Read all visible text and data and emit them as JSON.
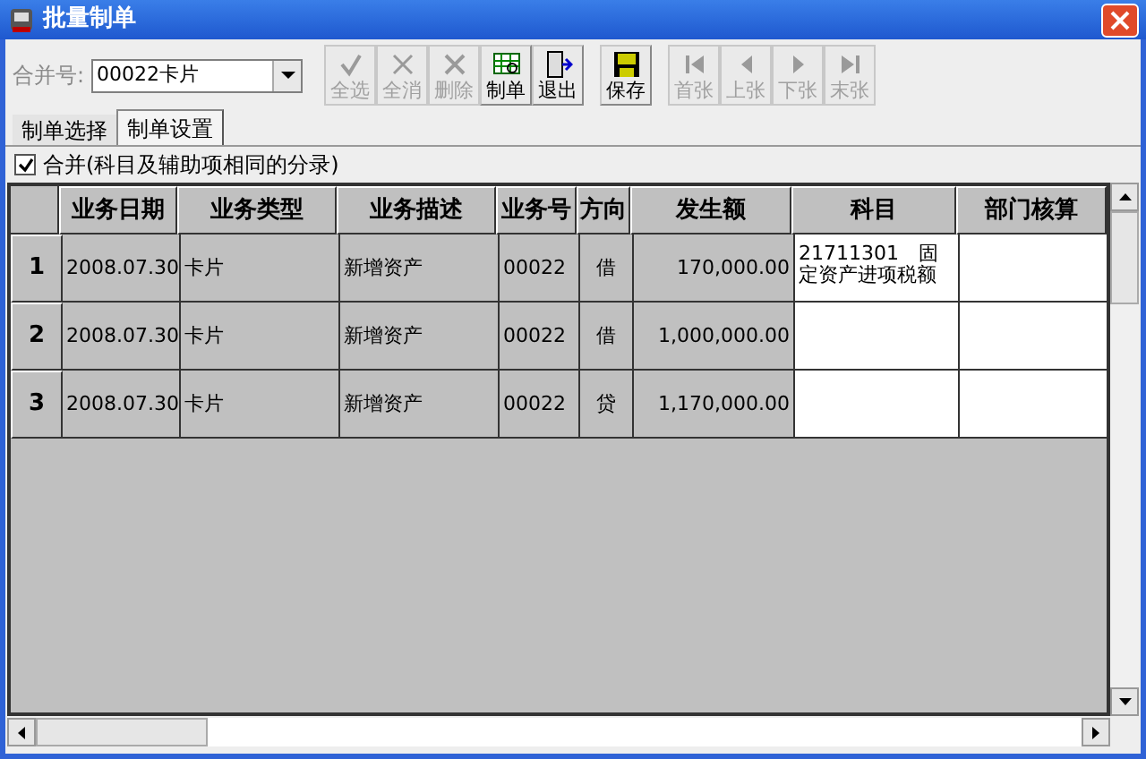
{
  "window": {
    "title": "批量制单"
  },
  "merge_field": {
    "label": "合并号:",
    "value": "00022卡片"
  },
  "toolbar": [
    {
      "kind": "select-all",
      "label": "全选",
      "disabled": true
    },
    {
      "kind": "clear-all",
      "label": "全消",
      "disabled": true
    },
    {
      "kind": "delete",
      "label": "删除",
      "disabled": true
    },
    {
      "kind": "make",
      "label": "制单",
      "disabled": false
    },
    {
      "kind": "exit",
      "label": "退出",
      "disabled": false
    },
    {
      "kind": "save",
      "label": "保存",
      "disabled": false
    },
    {
      "kind": "first",
      "label": "首张",
      "disabled": true
    },
    {
      "kind": "prev",
      "label": "上张",
      "disabled": true
    },
    {
      "kind": "next",
      "label": "下张",
      "disabled": true
    },
    {
      "kind": "last",
      "label": "末张",
      "disabled": true
    }
  ],
  "tabs": [
    {
      "label": "制单选择",
      "selected": false
    },
    {
      "label": "制单设置",
      "selected": true
    }
  ],
  "merge_checkbox": {
    "label": "合并(科目及辅助项相同的分录)",
    "checked": true
  },
  "table": {
    "columns": [
      "业务日期",
      "业务类型",
      "业务描述",
      "业务号",
      "方向",
      "发生额",
      "科目",
      "部门核算"
    ],
    "rows": [
      {
        "number": "1",
        "cells": [
          "2008.07.30",
          "卡片",
          "新增资产",
          "00022",
          "借",
          "170,000.00",
          "21711301　固定资产进项税额",
          ""
        ]
      },
      {
        "number": "2",
        "cells": [
          "2008.07.30",
          "卡片",
          "新增资产",
          "00022",
          "借",
          "1,000,000.00",
          "",
          ""
        ]
      },
      {
        "number": "3",
        "cells": [
          "2008.07.30",
          "卡片",
          "新增资产",
          "00022",
          "贷",
          "1,170,000.00",
          "",
          ""
        ]
      }
    ]
  }
}
